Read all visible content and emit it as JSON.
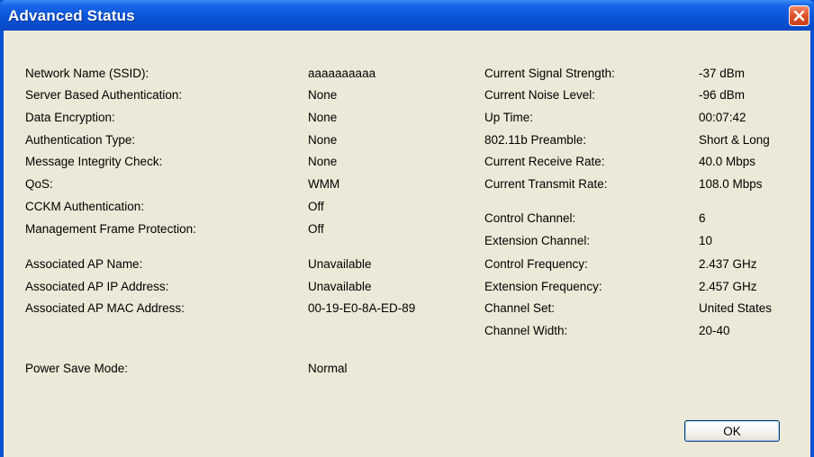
{
  "window": {
    "title": "Advanced Status",
    "close_icon": "close-icon"
  },
  "left_fields": [
    {
      "label": "Network Name (SSID):",
      "value": "aaaaaaaaaa"
    },
    {
      "label": "Server Based Authentication:",
      "value": "None"
    },
    {
      "label": "Data Encryption:",
      "value": "None"
    },
    {
      "label": "Authentication Type:",
      "value": "None"
    },
    {
      "label": "Message Integrity Check:",
      "value": "None"
    },
    {
      "label": "QoS:",
      "value": "WMM"
    },
    {
      "label": "CCKM Authentication:",
      "value": "Off"
    },
    {
      "label": "Management Frame Protection:",
      "value": "Off"
    },
    {
      "label": "Associated AP Name:",
      "value": "Unavailable"
    },
    {
      "label": "Associated AP IP Address:",
      "value": "Unavailable"
    },
    {
      "label": "Associated AP MAC Address:",
      "value": "00-19-E0-8A-ED-89"
    },
    {
      "label": "Power Save Mode:",
      "value": "Normal"
    }
  ],
  "right_fields": [
    {
      "label": "Current Signal Strength:",
      "value": "-37 dBm"
    },
    {
      "label": "Current Noise Level:",
      "value": "-96 dBm"
    },
    {
      "label": "Up Time:",
      "value": "00:07:42"
    },
    {
      "label": "802.11b Preamble:",
      "value": "Short & Long"
    },
    {
      "label": "Current Receive Rate:",
      "value": "40.0 Mbps"
    },
    {
      "label": "Current Transmit Rate:",
      "value": "108.0 Mbps"
    },
    {
      "label": "Control Channel:",
      "value": "6"
    },
    {
      "label": "Extension Channel:",
      "value": "10"
    },
    {
      "label": "Control Frequency:",
      "value": "2.437 GHz"
    },
    {
      "label": "Extension Frequency:",
      "value": "2.457 GHz"
    },
    {
      "label": "Channel Set:",
      "value": "United States"
    },
    {
      "label": "Channel Width:",
      "value": "20-40"
    }
  ],
  "buttons": {
    "ok_label": "OK"
  },
  "colors": {
    "title_bar": "#0a55d8",
    "client_background": "#ece9d8",
    "close_button": "#e0552d"
  }
}
